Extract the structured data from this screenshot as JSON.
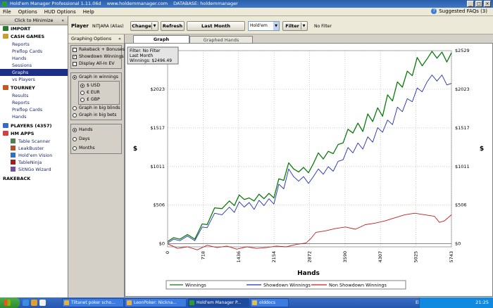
{
  "window": {
    "title_parts": [
      "Hold'em Manager Professional 1.11.06d",
      "www.holdemmanager.com",
      "DATABASE: holdemmanager"
    ],
    "controls": [
      "_",
      "□",
      "×"
    ]
  },
  "menu": {
    "items": [
      "File",
      "Options",
      "HUD Options",
      "Help"
    ],
    "faq_label": "Suggested FAQs (3)"
  },
  "sidebar": {
    "minimize_label": "Click to Minimize",
    "minimize_arrow": "«",
    "import_label": "IMPORT",
    "cash_games": {
      "label": "CASH GAMES",
      "items": [
        "Reports",
        "Preflop Cards",
        "Hands",
        "Sessions",
        "Graphs",
        "vs Players"
      ],
      "selected": "Graphs"
    },
    "tourney": {
      "label": "TOURNEY",
      "items": [
        "Results",
        "Reports",
        "Preflop Cards",
        "Hands"
      ]
    },
    "players_label": "PLAYERS (4357)",
    "hm_apps": {
      "label": "HM APPS",
      "items": [
        "Table Scanner",
        "LeakBuster",
        "Hold'em Vision",
        "TableNinja",
        "SitNGo Wizard"
      ]
    },
    "rakeback_label": "RAKEBACK"
  },
  "toolbar": {
    "player_label": "Player",
    "player_name": "NITJARA (Alias)",
    "change_label": "Change",
    "refresh_label": "Refresh",
    "date_label": "Last Month",
    "game_value": "Hold'em",
    "filter_label": "Filter",
    "filter_status": "No Filter"
  },
  "graphing_options": {
    "header": "Graphing Options",
    "checkboxes": [
      {
        "label": "Rakeback + Bonuses",
        "checked": false
      },
      {
        "label": "Showdown Winnings",
        "checked": true
      },
      {
        "label": "Display All-In EV",
        "checked": false
      }
    ],
    "graph_in_winnings": "Graph in winnings",
    "currencies": [
      {
        "label": "$ USD",
        "selected": true
      },
      {
        "label": "€ EUR",
        "selected": false
      },
      {
        "label": "£ GBP",
        "selected": false
      }
    ],
    "graph_in_big_blinds": "Graph in big blinds",
    "graph_in_big_bets": "Graph in big bets",
    "x_modes": [
      {
        "label": "Hands",
        "selected": true
      },
      {
        "label": "Days",
        "selected": false
      },
      {
        "label": "Months",
        "selected": false
      }
    ]
  },
  "tabs": [
    {
      "label": "Graph",
      "active": true
    },
    {
      "label": "Graphed Hands",
      "active": false
    }
  ],
  "chart_data": {
    "type": "line",
    "info_box": [
      "Filter: No Filter",
      "Last Month",
      "Winnings: $2496.49"
    ],
    "xlabel": "Hands",
    "ylabel": "$",
    "y_ticks": [
      "$0",
      "$506",
      "$1011",
      "$1517",
      "$2023",
      "$2529"
    ],
    "y_tick_values": [
      0,
      506,
      1011,
      1517,
      2023,
      2529
    ],
    "x_ticks": [
      "0",
      "718",
      "1436",
      "2154",
      "2872",
      "3590",
      "4307",
      "5025",
      "5743"
    ],
    "x_tick_values": [
      0,
      718,
      1436,
      2154,
      2872,
      3590,
      4307,
      5025,
      5743
    ],
    "xlim": [
      0,
      5743
    ],
    "ylim": [
      -40,
      2529
    ],
    "grid": true,
    "legend_placement": "bottom",
    "series": [
      {
        "name": "Winnings",
        "color": "#0a7a0a",
        "x": [
          0,
          120,
          250,
          400,
          550,
          700,
          800,
          950,
          1100,
          1250,
          1350,
          1450,
          1550,
          1650,
          1750,
          1850,
          1950,
          2050,
          2150,
          2250,
          2350,
          2450,
          2550,
          2650,
          2750,
          2850,
          2950,
          3050,
          3150,
          3250,
          3350,
          3450,
          3550,
          3650,
          3750,
          3850,
          3950,
          4050,
          4150,
          4250,
          4350,
          4450,
          4550,
          4650,
          4750,
          4850,
          4950,
          5050,
          5150,
          5250,
          5350,
          5450,
          5550,
          5650,
          5743
        ],
        "values": [
          30,
          80,
          60,
          120,
          60,
          260,
          250,
          470,
          460,
          560,
          500,
          640,
          580,
          600,
          560,
          650,
          590,
          660,
          600,
          850,
          830,
          1060,
          980,
          940,
          1000,
          930,
          1050,
          1190,
          1110,
          1210,
          1180,
          1300,
          1320,
          1500,
          1450,
          1580,
          1470,
          1700,
          1600,
          1780,
          1670,
          1950,
          1870,
          2120,
          2050,
          2260,
          2200,
          2440,
          2330,
          2420,
          2520,
          2430,
          2510,
          2380,
          2500
        ]
      },
      {
        "name": "Showdown Winnings",
        "color": "#2030b0",
        "x": [
          0,
          120,
          250,
          400,
          550,
          700,
          800,
          950,
          1100,
          1250,
          1350,
          1450,
          1550,
          1650,
          1750,
          1850,
          1950,
          2050,
          2150,
          2250,
          2350,
          2450,
          2550,
          2650,
          2750,
          2850,
          2950,
          3050,
          3150,
          3250,
          3350,
          3450,
          3550,
          3650,
          3750,
          3850,
          3950,
          4050,
          4150,
          4250,
          4350,
          4450,
          4550,
          4650,
          4750,
          4850,
          4950,
          5050,
          5150,
          5250,
          5350,
          5450,
          5550,
          5650,
          5743
        ],
        "values": [
          10,
          60,
          40,
          100,
          40,
          220,
          210,
          400,
          380,
          480,
          410,
          550,
          480,
          540,
          450,
          570,
          500,
          590,
          520,
          780,
          720,
          980,
          880,
          820,
          880,
          790,
          880,
          980,
          910,
          1010,
          950,
          1080,
          1100,
          1260,
          1190,
          1320,
          1240,
          1400,
          1330,
          1520,
          1460,
          1620,
          1560,
          1790,
          1730,
          1900,
          1860,
          2040,
          1990,
          2120,
          2210,
          2130,
          2210,
          2080,
          2100
        ]
      },
      {
        "name": "Non Showdown Winnings",
        "color": "#c02020",
        "x": [
          0,
          200,
          400,
          600,
          800,
          1000,
          1200,
          1400,
          1600,
          1800,
          2000,
          2200,
          2400,
          2600,
          2800,
          2900,
          3000,
          3200,
          3400,
          3600,
          3800,
          4000,
          4200,
          4400,
          4600,
          4800,
          5000,
          5200,
          5400,
          5500,
          5600,
          5743
        ],
        "values": [
          0,
          -60,
          -40,
          -80,
          -20,
          -50,
          -30,
          -70,
          -40,
          -60,
          -50,
          -30,
          -40,
          -10,
          10,
          70,
          150,
          170,
          200,
          220,
          190,
          250,
          270,
          300,
          340,
          380,
          400,
          380,
          360,
          280,
          300,
          380
        ]
      }
    ]
  }
}
